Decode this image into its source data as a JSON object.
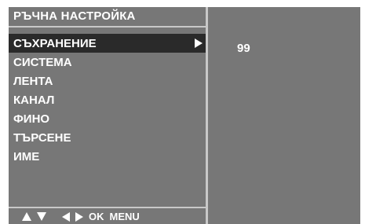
{
  "title": "РЪЧНА НАСТРОЙКА",
  "menu": {
    "items": [
      {
        "label": "СЪХРАНЕНИЕ",
        "selected": true
      },
      {
        "label": "СИСТЕМА",
        "selected": false
      },
      {
        "label": "ЛЕНТА",
        "selected": false
      },
      {
        "label": "КАНАЛ",
        "selected": false
      },
      {
        "label": "ФИНО",
        "selected": false
      },
      {
        "label": "ТЪРСЕНЕ",
        "selected": false
      },
      {
        "label": "ИМЕ",
        "selected": false
      }
    ]
  },
  "value_panel": {
    "value": "99"
  },
  "footer": {
    "ok_label": "OK",
    "menu_label": "MENU"
  },
  "colors": {
    "panel_bg": "#777777",
    "highlight": "#2a2a2a",
    "divider": "#c8c8c8",
    "text": "#ffffff"
  }
}
